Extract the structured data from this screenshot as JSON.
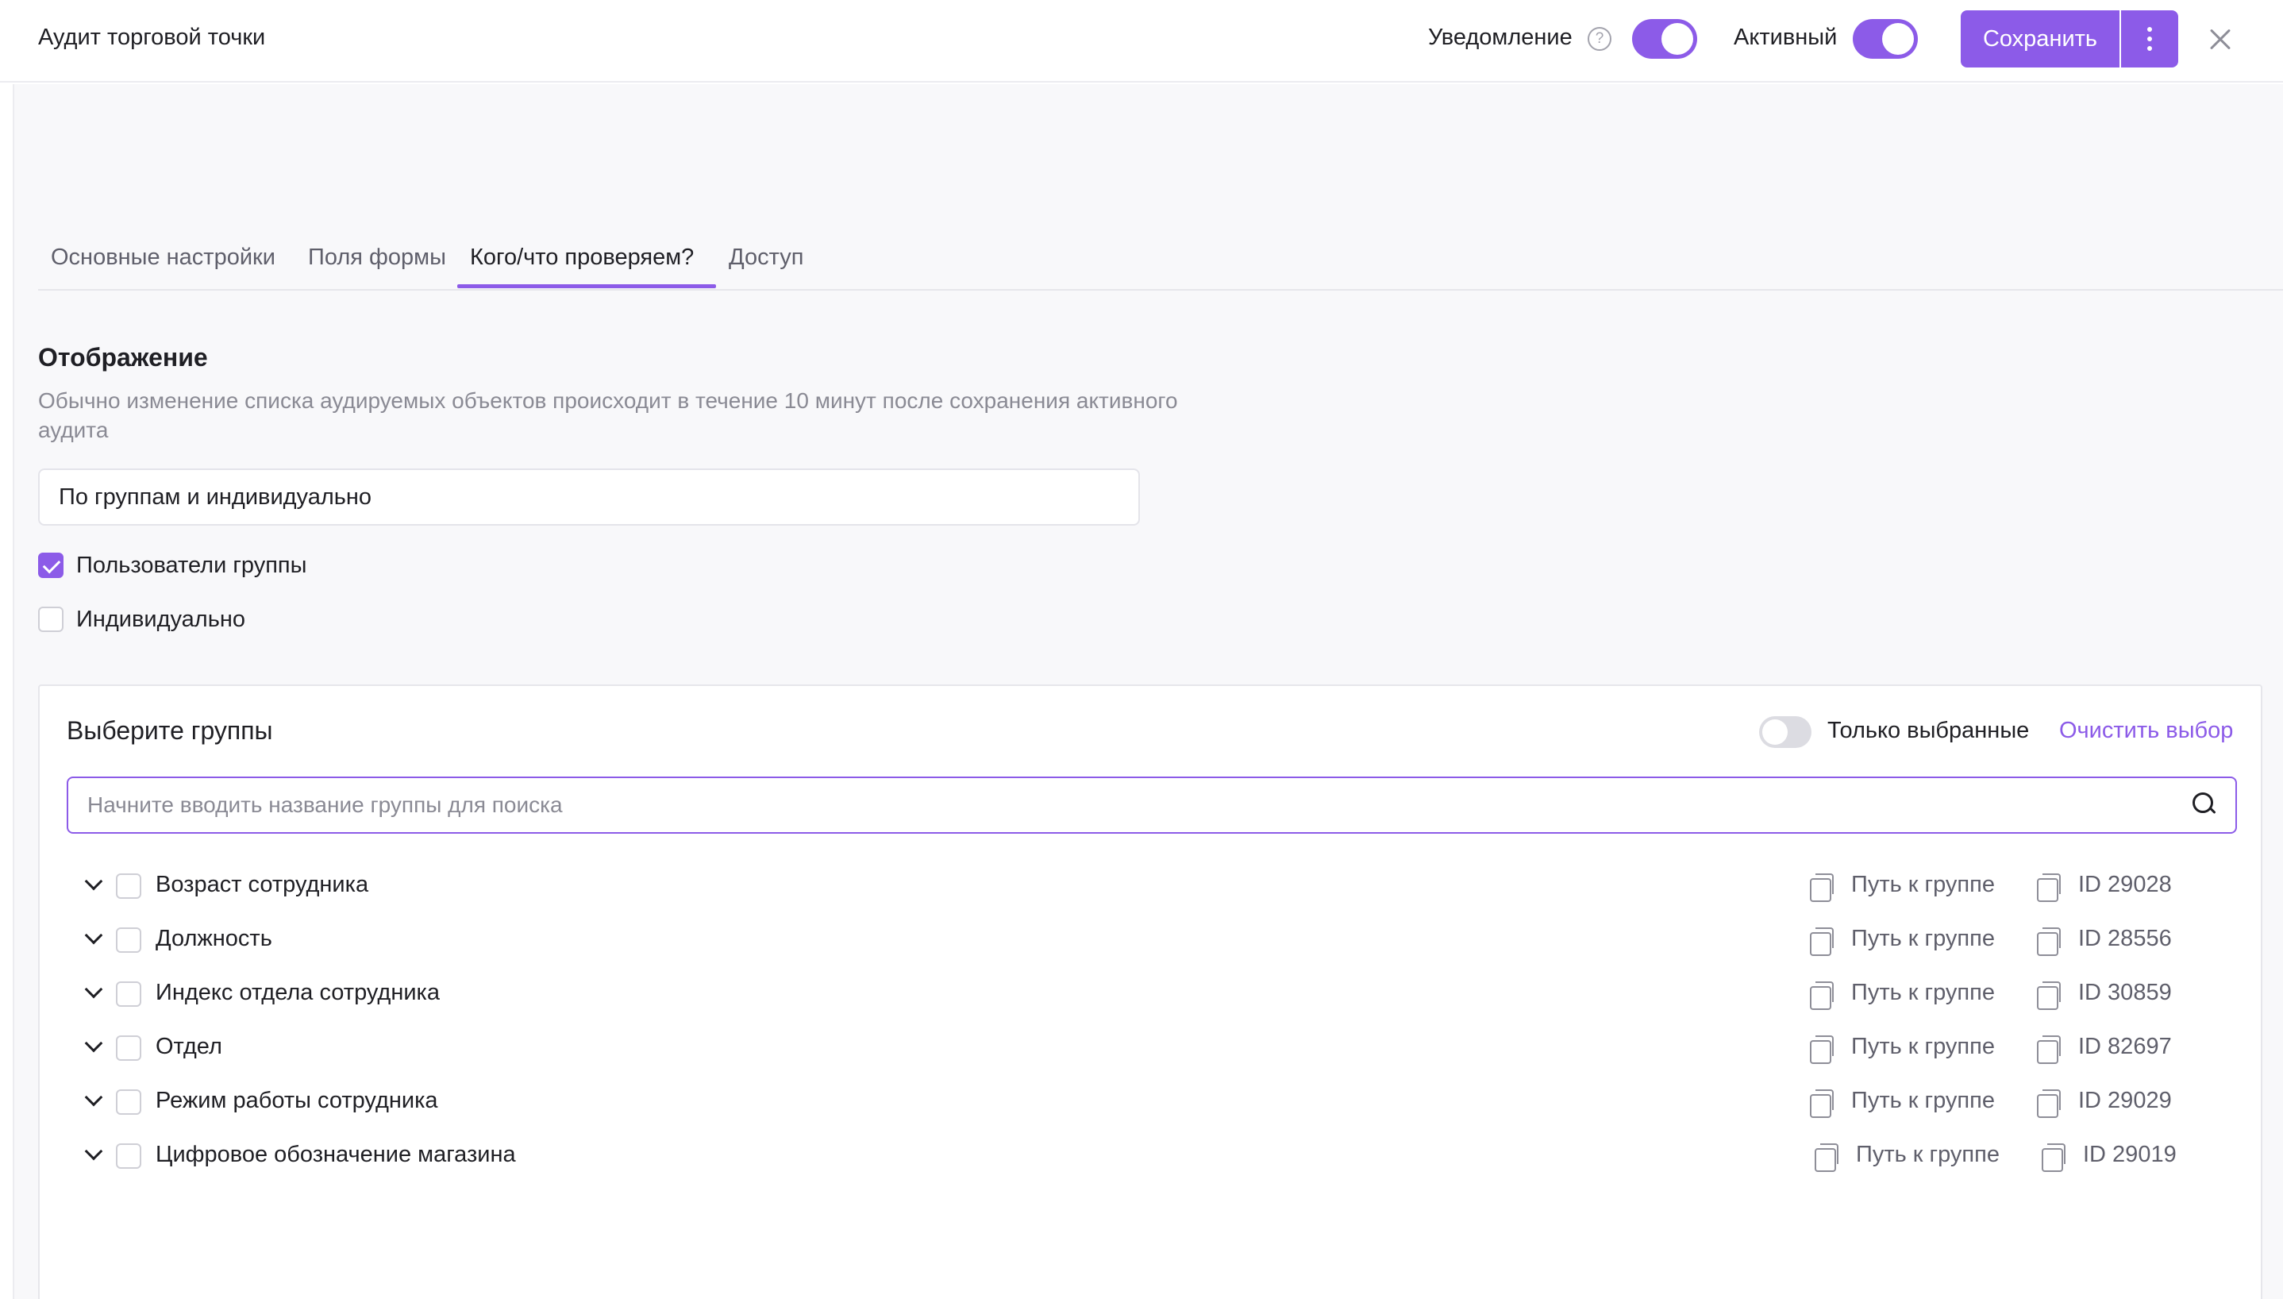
{
  "header": {
    "title": "Аудит торговой точки",
    "notification_label": "Уведомление",
    "notification_enabled": true,
    "active_label": "Активный",
    "active_enabled": true,
    "save_label": "Сохранить"
  },
  "tabs": [
    {
      "label": "Основные настройки",
      "active": false
    },
    {
      "label": "Поля формы",
      "active": false
    },
    {
      "label": "Кого/что проверяем?",
      "active": true
    },
    {
      "label": "Доступ",
      "active": false
    }
  ],
  "display": {
    "title": "Отображение",
    "description": "Обычно изменение списка аудируемых объектов происходит в течение 10 минут после сохранения активного аудита",
    "select_value": "По группам и индивидуально",
    "options": [
      {
        "label": "Пользователи группы",
        "checked": true
      },
      {
        "label": "Индивидуально",
        "checked": false
      }
    ]
  },
  "groups_panel": {
    "title": "Выберите группы",
    "only_selected_label": "Только выбранные",
    "only_selected_enabled": false,
    "clear_label": "Очистить выбор",
    "search_placeholder": "Начните вводить название группы для поиска",
    "rows": [
      {
        "name": "Возраст сотрудника",
        "path_label": "Путь к группе",
        "id_label": "ID 29028",
        "checked": false
      },
      {
        "name": "Должность",
        "path_label": "Путь к группе",
        "id_label": "ID 28556",
        "checked": false
      },
      {
        "name": "Индекс отдела сотрудника",
        "path_label": "Путь к группе",
        "id_label": "ID 30859",
        "checked": false
      },
      {
        "name": "Отдел",
        "path_label": "Путь к группе",
        "id_label": "ID 82697",
        "checked": false
      },
      {
        "name": "Режим работы сотрудника",
        "path_label": "Путь к группе",
        "id_label": "ID 29029",
        "checked": false
      },
      {
        "name": "Цифровое обозначение магазина",
        "path_label": "Путь к группе",
        "id_label": "ID 29019",
        "checked": false
      }
    ]
  },
  "colors": {
    "accent": "#8c5be8",
    "background": "#f8f8fa",
    "muted_text": "#8a8a94"
  }
}
